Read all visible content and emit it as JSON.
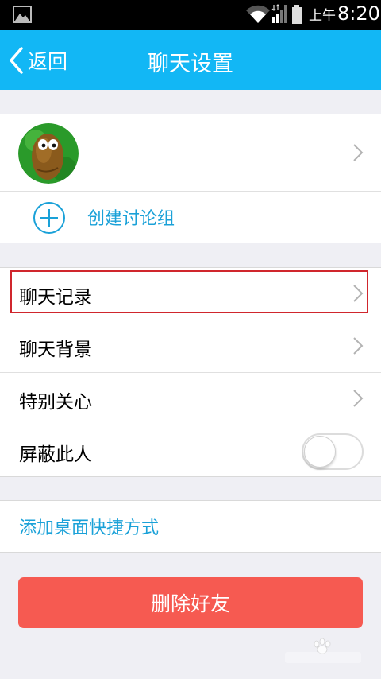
{
  "status_bar": {
    "ampm": "上午",
    "time": "8:20"
  },
  "nav": {
    "back_label": "返回",
    "title": "聊天设置"
  },
  "profile": {
    "create_group_label": "创建讨论组"
  },
  "settings": {
    "chat_history": "聊天记录",
    "chat_background": "聊天背景",
    "special_care": "特别关心",
    "block_person": "屏蔽此人",
    "block_enabled": false
  },
  "shortcut": {
    "label": "添加桌面快捷方式"
  },
  "actions": {
    "delete_friend": "删除好友"
  },
  "colors": {
    "nav_bar": "#12b7f5",
    "link_text": "#1aa1d8",
    "delete_button": "#f65a51",
    "highlight_border": "#d0262d",
    "page_background": "#efeff4"
  },
  "icons": [
    "gallery-icon",
    "wifi-icon",
    "signal-icon",
    "battery-icon",
    "chevron-left-icon",
    "chevron-right-icon",
    "add-circle-icon",
    "avatar"
  ]
}
